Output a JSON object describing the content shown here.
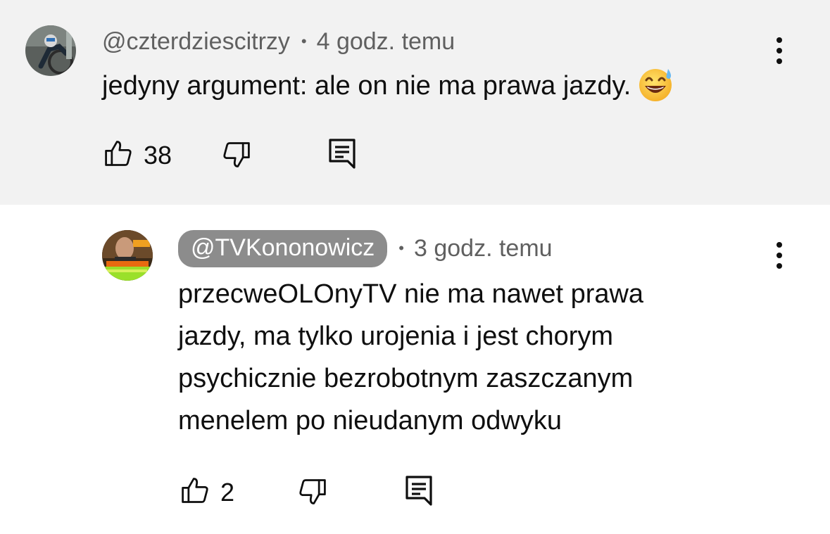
{
  "comment": {
    "handle": "@czterdziescitrzy",
    "separator": "•",
    "time": "4 godz. temu",
    "text": "jedyny argument: ale on nie ma prawa jazdy.",
    "emoji": "grinning-face-with-sweat",
    "like_count": "38",
    "avatar": "speedway-rider-avatar"
  },
  "reply": {
    "handle": "@TVKononowicz",
    "separator": "•",
    "time": "3 godz. temu",
    "text_lines": [
      "przecweOLOnyTV nie ma nawet prawa",
      "jazdy, ma tylko urojenia i jest chorym",
      "psychicznie bezrobotnym zaszczanym",
      "menelem po nieudanym odwyku"
    ],
    "like_count": "2",
    "avatar": "tv-kononowicz-avatar"
  },
  "icons": {
    "like": "thumbs-up-icon",
    "dislike": "thumbs-down-icon",
    "reply": "reply-comment-icon",
    "more": "more-vertical-icon"
  },
  "colors": {
    "top_background": "#f2f2f2",
    "chip_background": "#8c8c8c",
    "meta_text": "#606060"
  }
}
